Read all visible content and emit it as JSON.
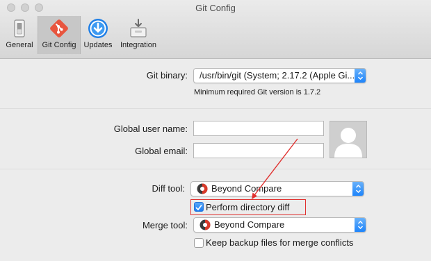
{
  "window": {
    "title": "Git Config"
  },
  "toolbar": {
    "items": [
      {
        "label": "General",
        "icon": "switch-icon"
      },
      {
        "label": "Git Config",
        "icon": "git-icon"
      },
      {
        "label": "Updates",
        "icon": "download-icon"
      },
      {
        "label": "Integration",
        "icon": "integration-icon"
      }
    ],
    "selected": "Git Config"
  },
  "git_binary": {
    "label": "Git binary:",
    "value": "/usr/bin/git (System; 2.17.2 (Apple Gi...",
    "note": "Minimum required Git version is 1.7.2"
  },
  "identity": {
    "user_name_label": "Global user name:",
    "user_name_value": "",
    "email_label": "Global email:",
    "email_value": ""
  },
  "diff_tool": {
    "label": "Diff tool:",
    "value": "Beyond Compare",
    "directory_diff_label": "Perform directory diff",
    "directory_diff_checked": true
  },
  "merge_tool": {
    "label": "Merge tool:",
    "value": "Beyond Compare",
    "keep_backup_label": "Keep backup files for merge conflicts",
    "keep_backup_checked": false
  },
  "colors": {
    "accent": "#1a82fb",
    "git_brand": "#e8553e",
    "annotation_red": "#e0312f"
  }
}
